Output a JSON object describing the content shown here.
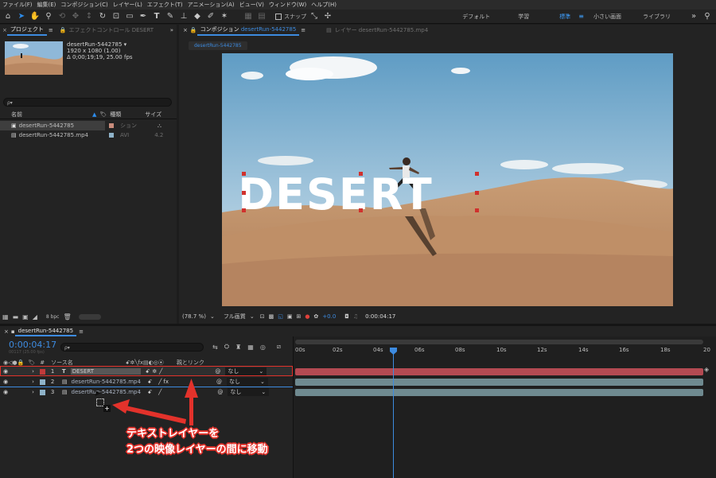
{
  "menu": [
    "ファイル(F)",
    "編集(E)",
    "コンポジション(C)",
    "レイヤー(L)",
    "エフェクト(T)",
    "アニメーション(A)",
    "ビュー(V)",
    "ウィンドウ(W)",
    "ヘルプ(H)"
  ],
  "toolbar": {
    "snap_label": "スナップ",
    "workspaces": [
      "デフォルト",
      "学習",
      "標準",
      "小さい画面",
      "ライブラリ"
    ],
    "active_workspace": "標準"
  },
  "project": {
    "tab": "プロジェクト",
    "tab2": "エフェクトコントロール DESERT",
    "name": "desertRun-5442785 ▾",
    "resolution": "1920 x 1080 (1.00)",
    "duration": "Δ 0;00;19;19, 25.00 fps",
    "search_placeholder": "ρ▾",
    "columns": {
      "name": "名前",
      "type": "種類",
      "size": "サイズ"
    },
    "items": [
      {
        "name": "desertRun-5442785",
        "type": "コンポジション",
        "type_short": "ション",
        "color": "#c98c7c"
      },
      {
        "name": "desertRun-5442785.mp4",
        "type": "AVI",
        "size": "4.2",
        "color": "#8fb3c9"
      }
    ],
    "bpc": "8 bpc"
  },
  "composition": {
    "tab_prefix": "コンポジション",
    "tab_name": "desertRun-5442785",
    "layer_tab": "レイヤー desertRun-5442785.mp4",
    "flow_label": "desertRun-5442785",
    "title_text": "DESERT",
    "zoom": "(78.7 %)",
    "quality": "フル画質",
    "exposure": "+0.0",
    "timecode": "0:00:04:17"
  },
  "timeline": {
    "tab": "desertRun-5442785",
    "timecode": "0:00:04:17",
    "frame_info": "00117 (25.00 fps)",
    "search_placeholder": "ρ▾",
    "col_hash": "#",
    "col_source": "ソース名",
    "col_parent": "親とリンク",
    "ruler": [
      "00s",
      "02s",
      "04s",
      "06s",
      "08s",
      "10s",
      "12s",
      "14s",
      "16s",
      "18s",
      "20"
    ],
    "layers": [
      {
        "num": "1",
        "name": "DESERT",
        "parent": "なし",
        "color": "#c13a3a",
        "bar_color": "#b44a52"
      },
      {
        "num": "2",
        "name": "desertRun-5442785.mp4",
        "parent": "なし",
        "color": "#8fb3c9",
        "bar_color": "#6f8a90"
      },
      {
        "num": "3",
        "name": "desertRun-5442785.mp4",
        "parent": "なし",
        "color": "#8fb3c9",
        "bar_color": "#6f8a90"
      }
    ],
    "playhead_seconds": 4.68
  },
  "annotation": {
    "line1": "テキストレイヤーを",
    "line2": "2つの映像レイヤーの間に移動",
    "color": "#e3322b"
  }
}
